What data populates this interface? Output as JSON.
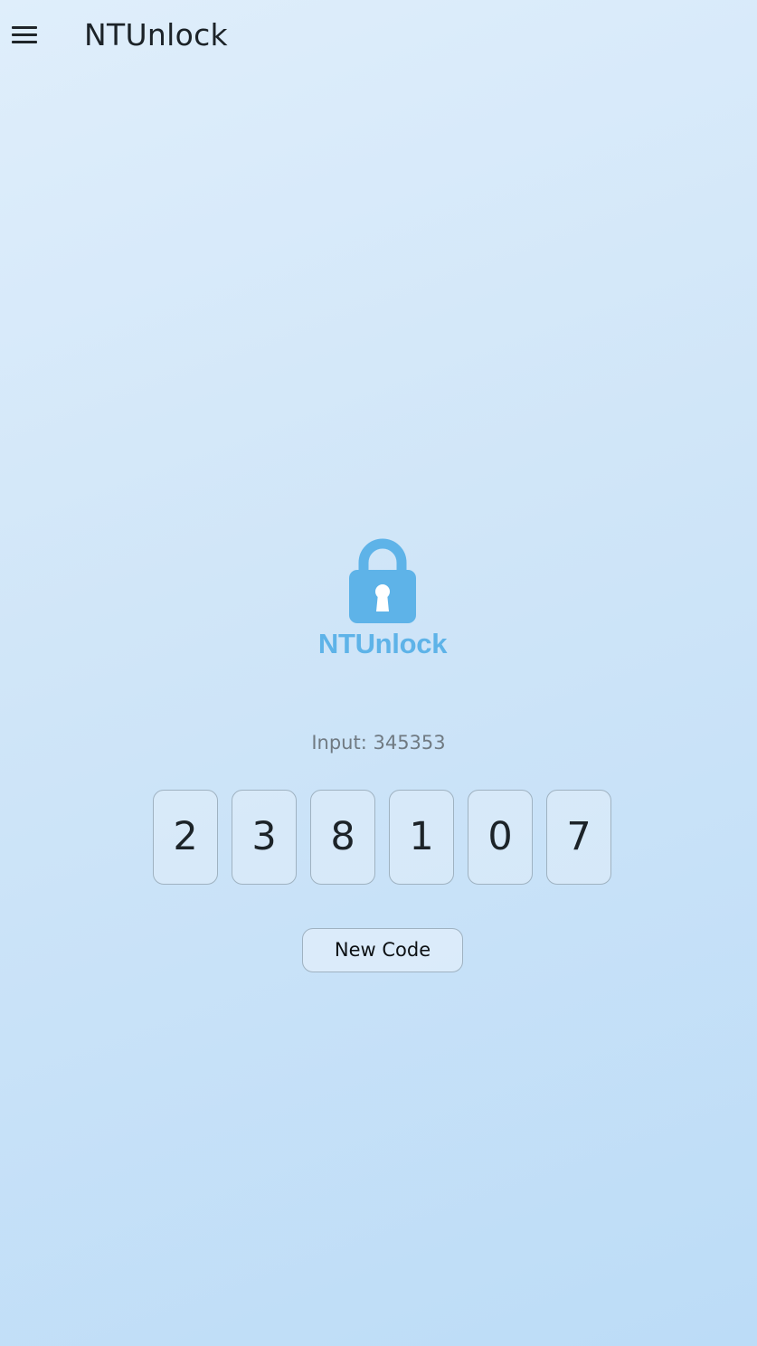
{
  "app_bar": {
    "menu_icon": "hamburger-menu-icon",
    "title": "NTUnlock"
  },
  "logo": {
    "icon": "padlock-icon",
    "text": "NTUnlock",
    "color": "#5eb3e8"
  },
  "input_display": {
    "text": "Input: 345353"
  },
  "code": {
    "digits": [
      "2",
      "3",
      "8",
      "1",
      "0",
      "7"
    ]
  },
  "actions": {
    "new_code_label": "New Code"
  },
  "colors": {
    "background_top": "#dfeefb",
    "background_bottom": "#bcdcf7",
    "accent": "#5eb3e8",
    "box_border": "#9fb2c1"
  }
}
